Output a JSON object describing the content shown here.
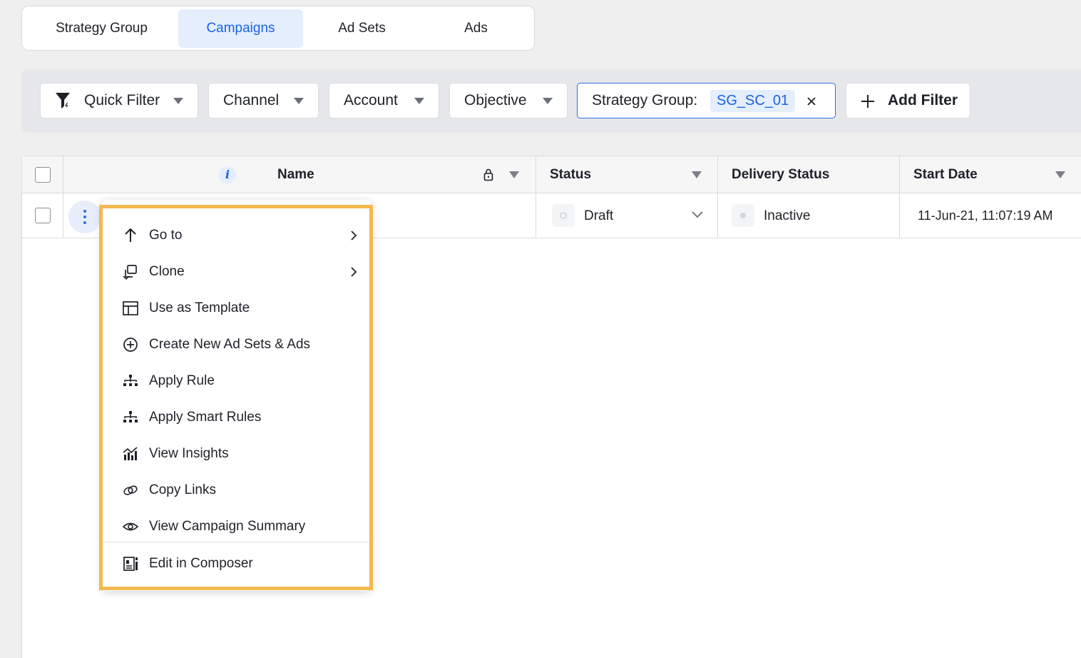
{
  "tabs": [
    {
      "label": "Strategy Group"
    },
    {
      "label": "Campaigns"
    },
    {
      "label": "Ad Sets"
    },
    {
      "label": "Ads"
    }
  ],
  "filters": {
    "quick_filter": "Quick Filter",
    "channel": "Channel",
    "account": "Account",
    "objective": "Objective",
    "strategy_group_label": "Strategy Group:",
    "strategy_group_value": "SG_SC_01",
    "add_filter": "Add Filter"
  },
  "table": {
    "columns": {
      "name": "Name",
      "status": "Status",
      "delivery_status": "Delivery Status",
      "start_date": "Start Date"
    },
    "rows": [
      {
        "status": "Draft",
        "delivery_status": "Inactive",
        "start_date": "11-Jun-21, 11:07:19 AM"
      }
    ]
  },
  "menu": {
    "items": [
      {
        "label": "Go to",
        "icon": "arrow-up-icon"
      },
      {
        "label": "Clone",
        "icon": "clone-icon"
      },
      {
        "label": "Use as Template",
        "icon": "template-icon"
      },
      {
        "label": "Create New Ad Sets & Ads",
        "icon": "plus-circle-icon"
      },
      {
        "label": "Apply Rule",
        "icon": "hierarchy-icon"
      },
      {
        "label": "Apply Smart Rules",
        "icon": "hierarchy-icon"
      },
      {
        "label": "View Insights",
        "icon": "insights-icon"
      },
      {
        "label": "Copy Links",
        "icon": "link-icon"
      },
      {
        "label": "View Campaign Summary",
        "icon": "eye-icon"
      },
      {
        "label": "Edit in Composer",
        "icon": "composer-icon"
      }
    ]
  },
  "colors": {
    "accent": "#1a62e8",
    "highlight_border": "#f3b94e",
    "active_tab_bg": "#e4eefd"
  }
}
